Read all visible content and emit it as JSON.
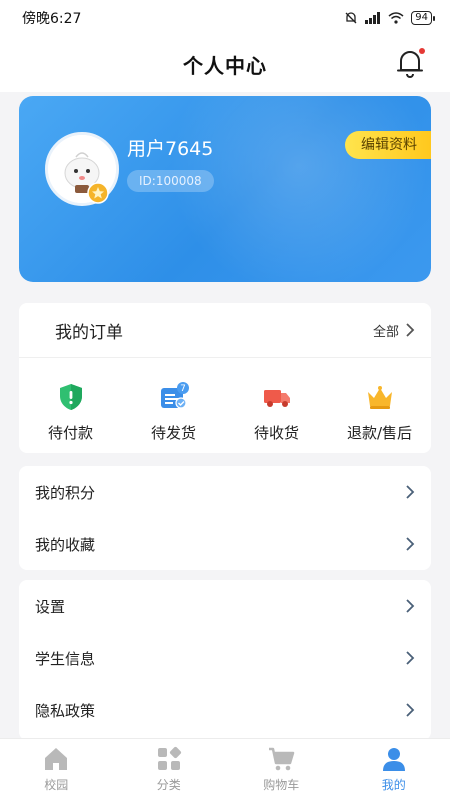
{
  "status_bar": {
    "time": "傍晚6:27",
    "battery": "94"
  },
  "header": {
    "title": "个人中心"
  },
  "profile": {
    "username": "用户7645",
    "user_id": "ID:100008",
    "edit_label": "编辑资料"
  },
  "orders": {
    "title": "我的订单",
    "all_label": "全部",
    "items": [
      {
        "label": "待付款",
        "icon": "shield-pay-icon"
      },
      {
        "label": "待发货",
        "icon": "calendar-ship-icon",
        "badge": "7"
      },
      {
        "label": "待收货",
        "icon": "truck-icon"
      },
      {
        "label": "退款/售后",
        "icon": "crown-icon"
      }
    ]
  },
  "menu_group1": [
    {
      "label": "我的积分"
    },
    {
      "label": "我的收藏"
    }
  ],
  "menu_group2": [
    {
      "label": "设置"
    },
    {
      "label": "学生信息"
    },
    {
      "label": "隐私政策"
    }
  ],
  "tabs": [
    {
      "label": "校园",
      "icon": "home-icon"
    },
    {
      "label": "分类",
      "icon": "category-icon"
    },
    {
      "label": "购物车",
      "icon": "cart-icon"
    },
    {
      "label": "我的",
      "icon": "user-icon",
      "active": true
    }
  ],
  "colors": {
    "primary": "#3b8ee8",
    "edit_button": "#ffd633",
    "bell_dot": "#e53935"
  }
}
